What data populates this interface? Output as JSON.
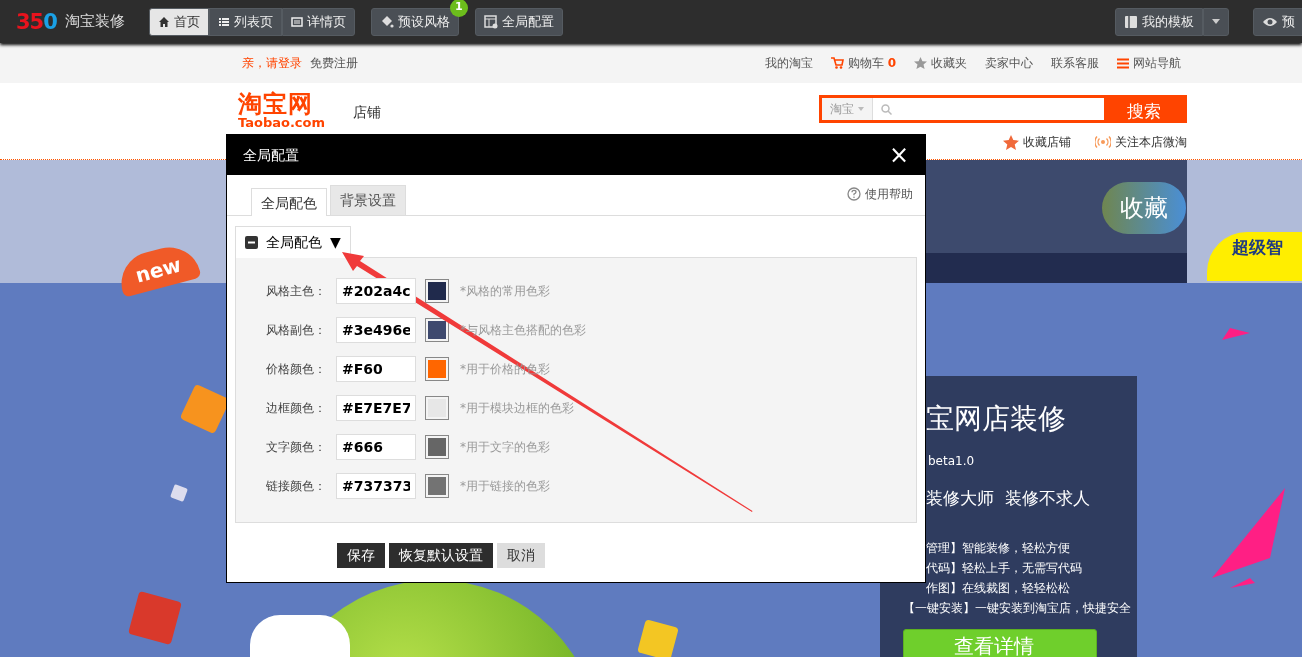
{
  "toolbar": {
    "logo_number": "350",
    "logo_text": "淘宝装修",
    "page_tabs": [
      {
        "label": "首页",
        "selected": true
      },
      {
        "label": "列表页",
        "selected": false
      },
      {
        "label": "详情页",
        "selected": false
      }
    ],
    "preset_button": {
      "label": "预设风格",
      "badge": "1"
    },
    "config_button": {
      "label": "全局配置"
    },
    "templates_button": {
      "label": "我的模板"
    },
    "preview_button": {
      "label": "预"
    }
  },
  "site_bar": {
    "login": "亲，请登录",
    "register": "免费注册",
    "links": [
      {
        "label": "我的淘宝"
      },
      {
        "label": "购物车",
        "count": "0"
      },
      {
        "label": "收藏夹"
      },
      {
        "label": "卖家中心"
      },
      {
        "label": "联系客服"
      },
      {
        "label": "网站导航"
      }
    ]
  },
  "header": {
    "logo_cn": "淘宝网",
    "logo_en": "Taobao.com",
    "shop_label": "店铺",
    "search_scope": "淘宝",
    "search_button": "搜索",
    "shop_actions": [
      "收藏店铺",
      "关注本店微淘"
    ]
  },
  "banner": {
    "sticker": "new",
    "collect_badge": "收藏",
    "promo_text": "超级智",
    "title": "宝网店装修",
    "version": "beta1.0",
    "slogan": "装修大师  装修不求人",
    "features": [
      "管理】智能装修，轻松方便",
      "代码】轻松上手，无需写代码",
      "作图】在线裁图，轻轻松松",
      "【一键安装】一键安装到淘宝店，快捷安全"
    ],
    "cta": "查看详情"
  },
  "dialog": {
    "title": "全局配置",
    "close": "×",
    "tabs": [
      {
        "label": "全局配色",
        "selected": true
      },
      {
        "label": "背景设置",
        "selected": false
      }
    ],
    "help": "使用帮助",
    "section": {
      "title": "全局配色",
      "expanded": true,
      "caret": "▼"
    },
    "fields": [
      {
        "label": "风格主色：",
        "value": "#202a4c",
        "color": "#202a4c",
        "hint": "*风格的常用色彩"
      },
      {
        "label": "风格副色：",
        "value": "#3e496e",
        "color": "#3e496e",
        "hint": "*与风格主色搭配的色彩"
      },
      {
        "label": "价格颜色：",
        "value": "#F60",
        "color": "#ff6600",
        "hint": "*用于价格的色彩"
      },
      {
        "label": "边框颜色：",
        "value": "#E7E7E7",
        "color": "#e7e7e7",
        "hint": "*用于模块边框的色彩"
      },
      {
        "label": "文字颜色：",
        "value": "#666",
        "color": "#666666",
        "hint": "*用于文字的色彩"
      },
      {
        "label": "链接颜色：",
        "value": "#737373",
        "color": "#737373",
        "hint": "*用于链接的色彩"
      }
    ],
    "buttons": [
      {
        "label": "保存",
        "kind": "primary"
      },
      {
        "label": "恢复默认设置",
        "kind": "primary"
      },
      {
        "label": "取消",
        "kind": "secondary"
      }
    ]
  }
}
